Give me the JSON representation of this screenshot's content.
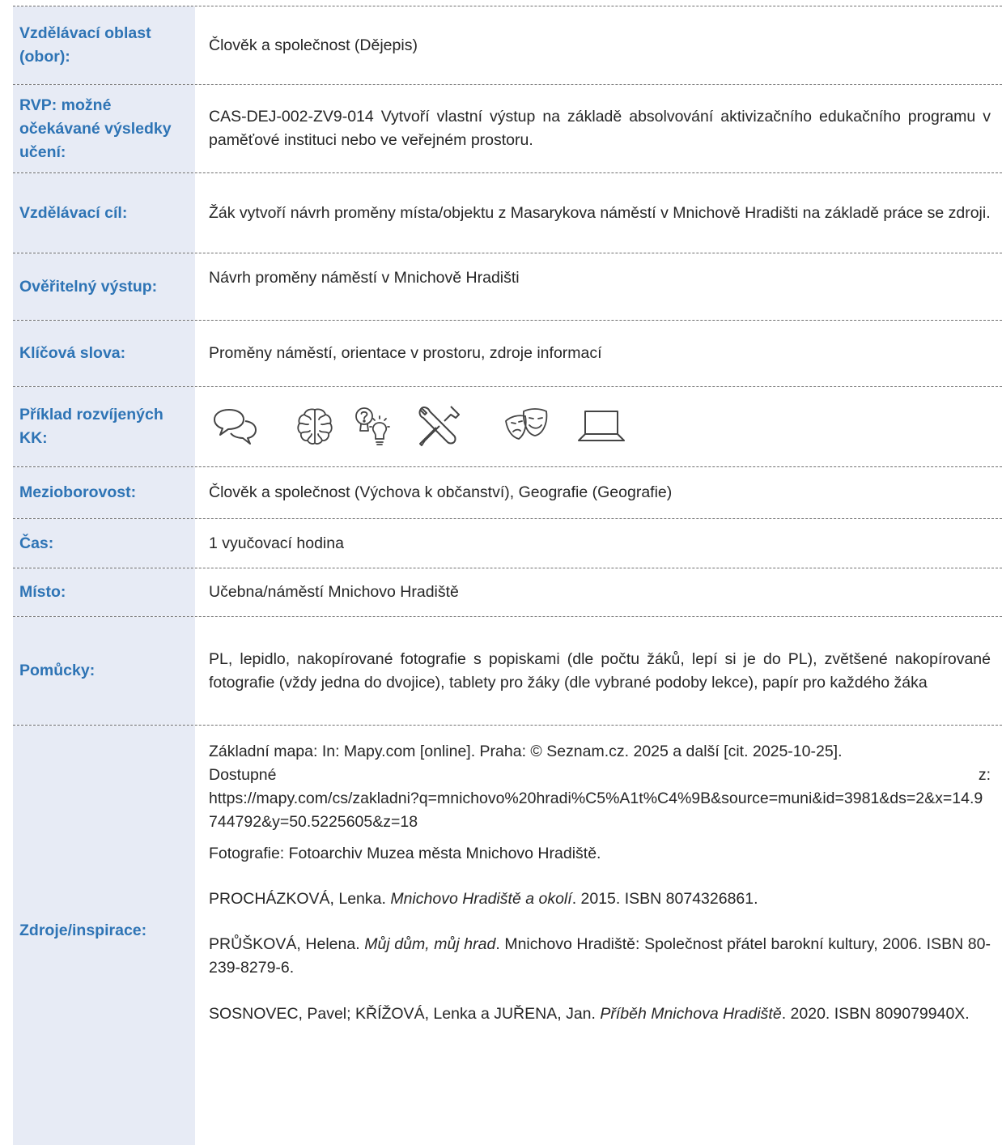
{
  "rows": {
    "oblast": {
      "label": "Vzdělávací oblast (obor):",
      "value": "Člověk a společnost (Dějepis)"
    },
    "rvp": {
      "label": "RVP: možné očekávané výsledky učení:",
      "value": "CAS-DEJ-002-ZV9-014 Vytvoří vlastní výstup na základě absolvování aktivizačního edukačního programu v paměťové instituci nebo ve veřejném prostoru."
    },
    "cil": {
      "label": "Vzdělávací cíl:",
      "value": "Žák vytvoří návrh proměny místa/objektu z Masarykova náměstí v Mnichově Hradišti na základě práce se zdroji."
    },
    "vystup": {
      "label": "Ověřitelný výstup:",
      "value": "Návrh proměny náměstí v Mnichově Hradišti"
    },
    "slova": {
      "label": "Klíčová slova:",
      "value": "Proměny náměstí, orientace v prostoru, zdroje informací"
    },
    "kk": {
      "label": "Příklad rozvíjených KK:",
      "icons": [
        "speech-bubbles-icon",
        "brain-icon",
        "question-bulb-icon",
        "tools-icon",
        "theater-masks-icon",
        "laptop-icon"
      ]
    },
    "mezi": {
      "label": "Mezioborovost:",
      "value": "Člověk a společnost (Výchova k občanství), Geografie (Geografie)"
    },
    "cas": {
      "label": "Čas:",
      "value": "1 vyučovací hodina"
    },
    "misto": {
      "label": "Místo:",
      "value": "Učebna/náměstí Mnichovo Hradiště"
    },
    "pomucky": {
      "label": "Pomůcky:",
      "value": "PL, lepidlo, nakopírované fotografie s popiskami (dle počtu žáků, lepí si je do PL), zvětšené nakopírované fotografie (vždy jedna do dvojice), tablety pro žáky (dle vybrané podoby lekce), papír pro každého žáka"
    },
    "zdroje": {
      "label": "Zdroje/inspirace:",
      "map_text": "Základní mapa: In: Mapy.com [online]. Praha: © Seznam.cz. 2025 a další [cit. 2025-10-25].",
      "map_avail": "Dostupné",
      "map_z": "z:",
      "map_url": "https://mapy.com/cs/zakladni?q=mnichovo%20hradi%C5%A1t%C4%9B&source=muni&id=3981&ds=2&x=14.9744792&y=50.5225605&z=18",
      "photo": "Fotografie: Fotoarchiv Muzea města Mnichovo Hradiště.",
      "ref1_author": "PROCHÁZKOVÁ, Lenka. ",
      "ref1_title": "Mnichovo Hradiště a okolí",
      "ref1_rest": ". 2015. ISBN 8074326861.",
      "ref2_author": "PRŮŠKOVÁ, Helena. ",
      "ref2_title": "Můj dům, můj hrad",
      "ref2_rest": ". Mnichovo Hradiště: Společnost přátel barokní kultury, 2006. ISBN 80-239-8279-6.",
      "ref3_author": "SOSNOVEC, Pavel; KŘÍŽOVÁ, Lenka a JUŘENA, Jan. ",
      "ref3_title": "Příběh Mnichova Hradiště",
      "ref3_rest": ". 2020. ISBN 809079940X."
    }
  },
  "colors": {
    "label_bg": "#e7ebf5",
    "label_text": "#2e74b5",
    "body_text": "#262626",
    "divider": "#6f6f6f"
  }
}
